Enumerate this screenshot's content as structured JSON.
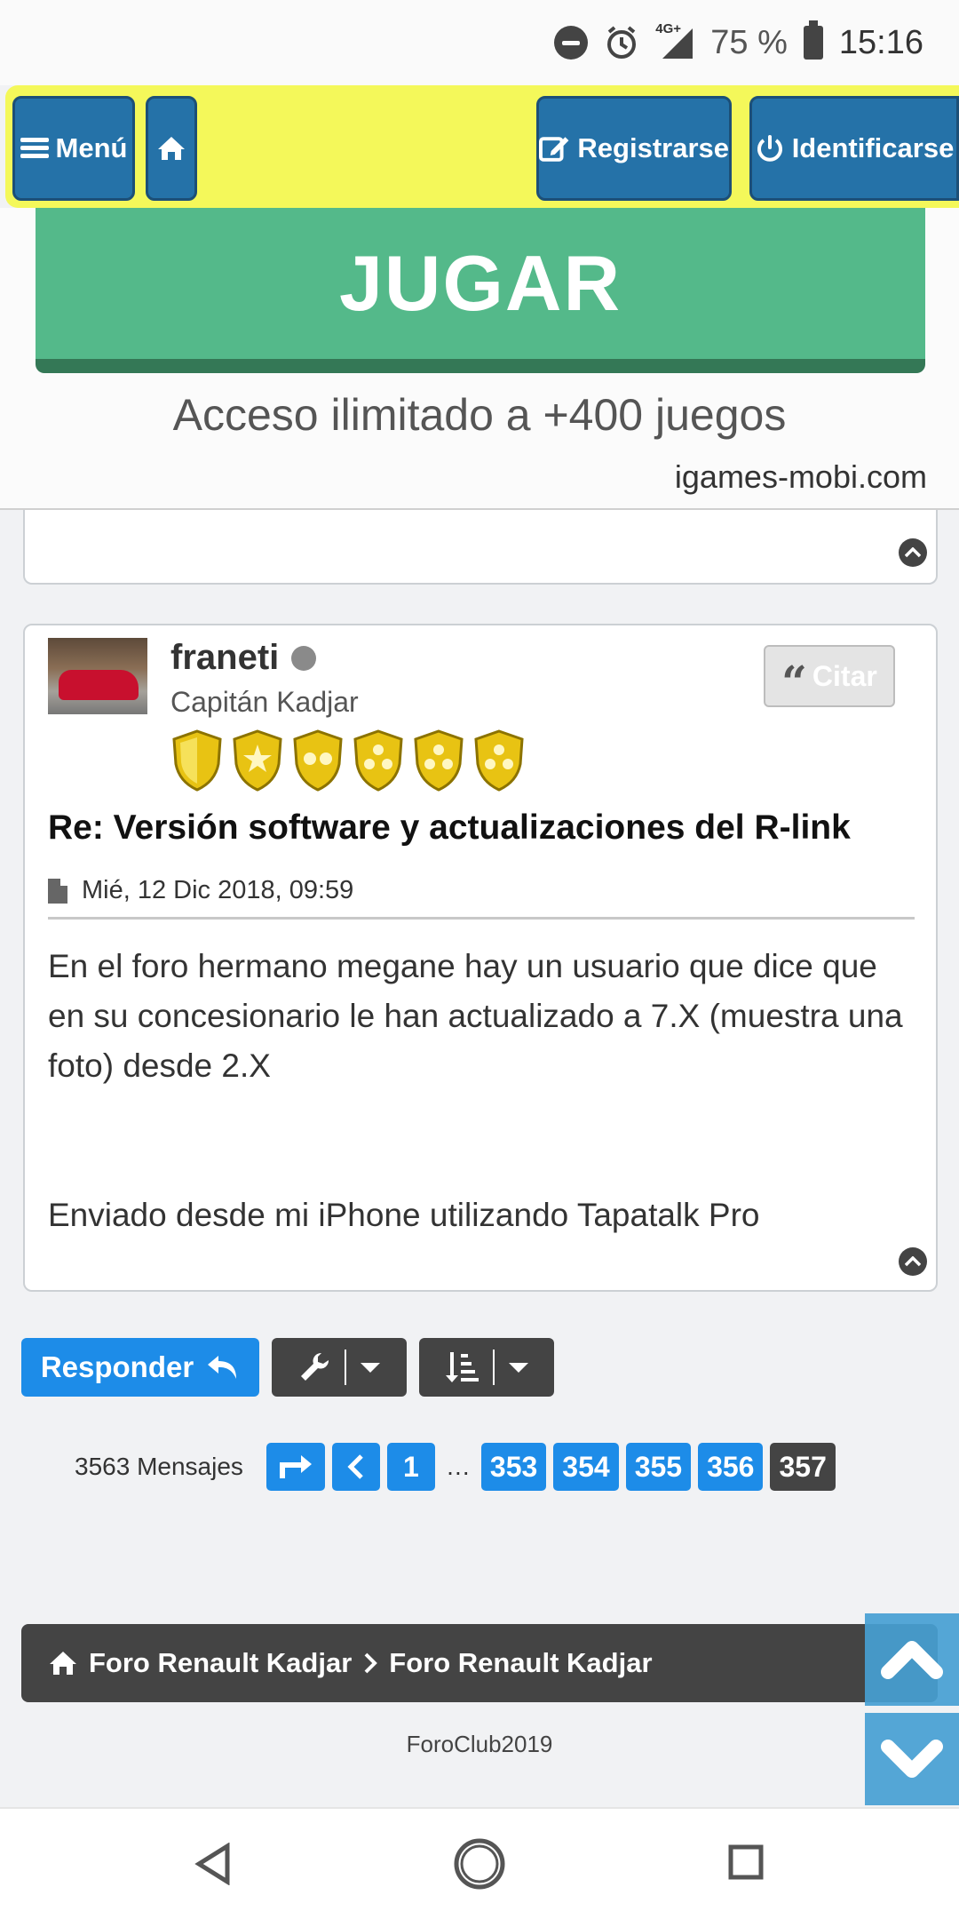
{
  "status_bar": {
    "network": "4G+",
    "battery_pct": "75 %",
    "time": "15:16",
    "icons": [
      "do-not-disturb-icon",
      "alarm-icon",
      "signal-icon",
      "battery-icon"
    ]
  },
  "topnav": {
    "menu_label": "Menú",
    "register_label": "Registrarse",
    "login_label": "Identificarse",
    "bg_color": "#f4f85a",
    "button_color": "#2572a8"
  },
  "ad": {
    "button_label": "JUGAR",
    "tagline": "Acceso ilimitado a +400 juegos",
    "url": "igames-mobi.com",
    "button_color": "#54b98a"
  },
  "post": {
    "username": "franeti",
    "rank": "Capitán Kadjar",
    "rank_shields": 6,
    "quote_label": "Citar",
    "title": "Re: Versión software y actualizaciones del R-link",
    "date": "Mié, 12 Dic 2018, 09:59",
    "body_line1": "En el foro hermano megane hay un usuario que dice que en su concesionario le han actualizado a 7.X (muestra una foto) desde 2.X",
    "signature": "Enviado desde mi iPhone utilizando Tapatalk Pro"
  },
  "actions": {
    "reply_label": "Responder"
  },
  "pagination": {
    "message_count": "3563 Mensajes",
    "first_page": "1",
    "ellipsis": "…",
    "pages": [
      "353",
      "354",
      "355",
      "356"
    ],
    "current_page": "357"
  },
  "breadcrumb": {
    "item1": "Foro Renault Kadjar",
    "item2": "Foro Renault Kadjar"
  },
  "footer": {
    "text": "ForoClub2019"
  }
}
